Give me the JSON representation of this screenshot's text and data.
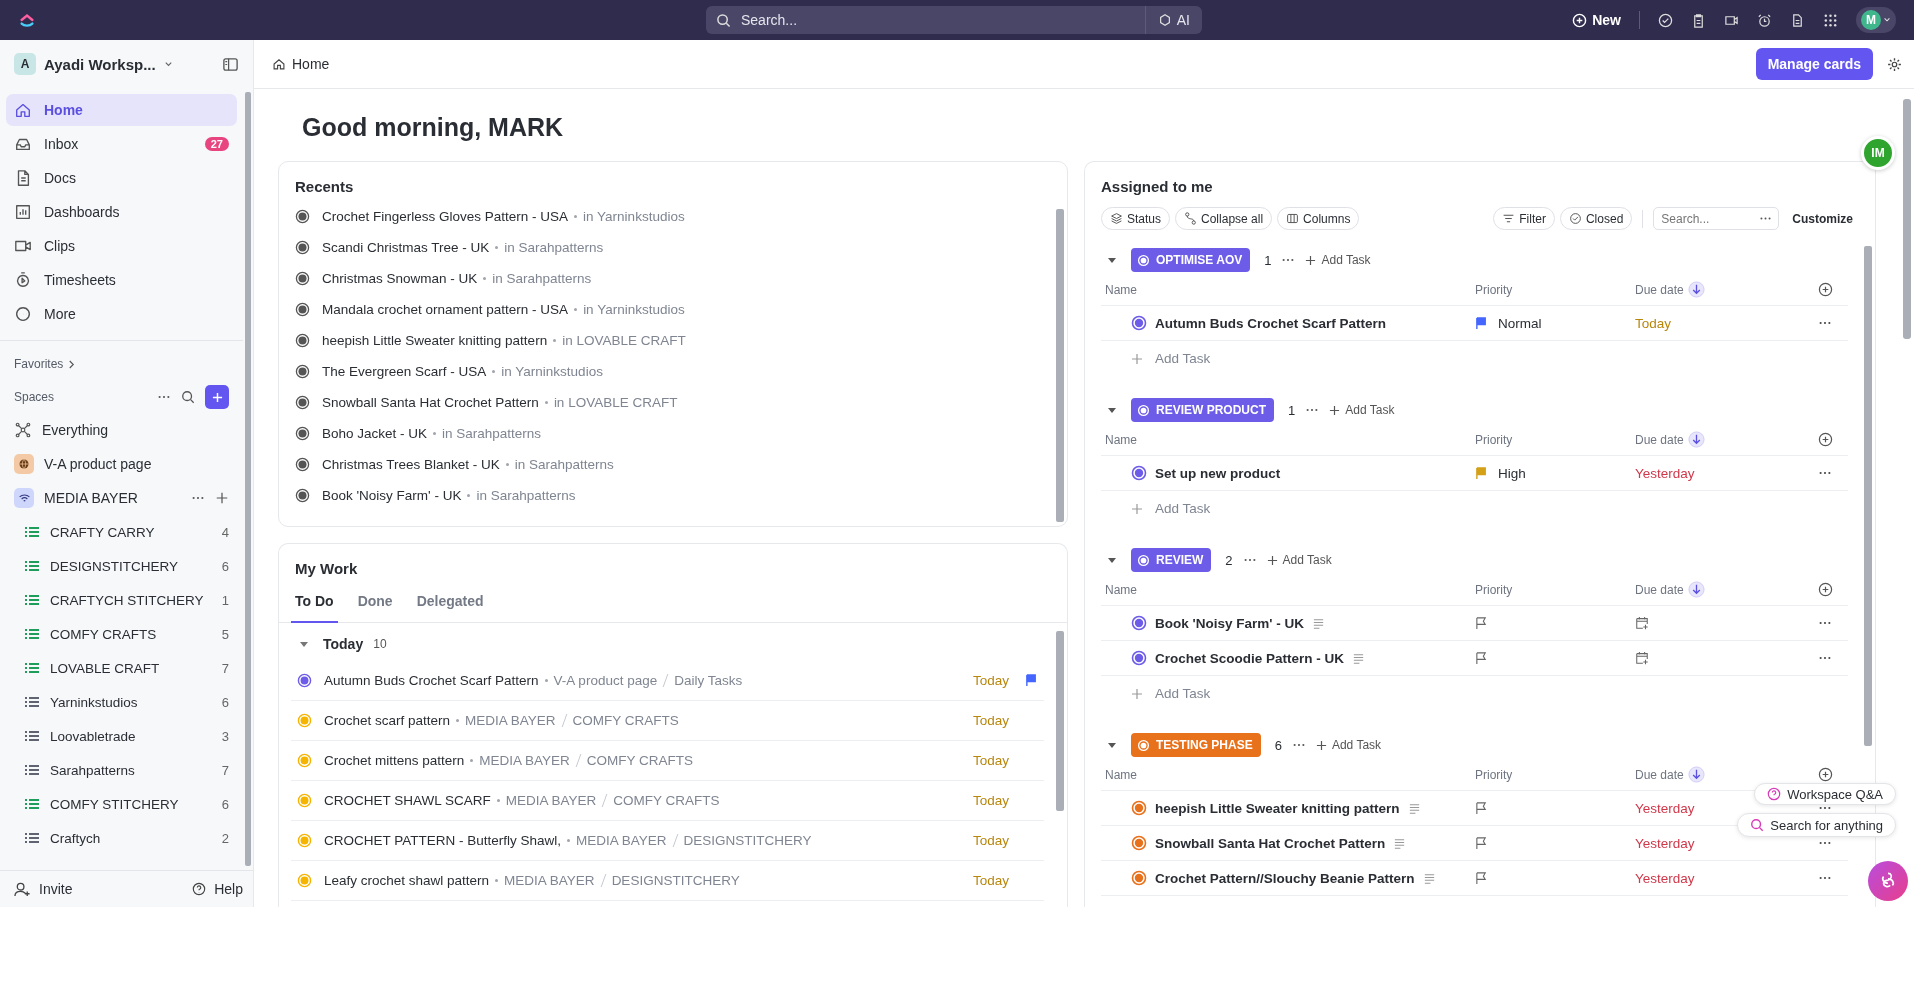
{
  "topbar": {
    "search": {
      "placeholder": "Search..."
    },
    "ai_label": "AI",
    "new_label": "New",
    "avatar": "M"
  },
  "sidebar": {
    "workspace": {
      "initial": "A",
      "name": "Ayadi Worksp..."
    },
    "nav": [
      {
        "label": "Home",
        "selected": true
      },
      {
        "label": "Inbox",
        "selected": false,
        "badge": "27"
      },
      {
        "label": "Docs",
        "selected": false
      },
      {
        "label": "Dashboards",
        "selected": false
      },
      {
        "label": "Clips",
        "selected": false
      },
      {
        "label": "Timesheets",
        "selected": false
      },
      {
        "label": "More",
        "selected": false
      }
    ],
    "favorites_label": "Favorites",
    "spaces_label": "Spaces",
    "spaces": [
      {
        "label": "Everything",
        "kind": "everything"
      },
      {
        "label": "V-A product page",
        "kind": "globe"
      },
      {
        "label": "MEDIA BAYER",
        "kind": "wifi",
        "children": [
          {
            "label": "CRAFTY CARRY",
            "count": "4",
            "color": "#1e9e5a"
          },
          {
            "label": "DESIGNSTITCHERY",
            "count": "6",
            "color": "#1e9e5a"
          },
          {
            "label": "CRAFTYCH STITCHERY",
            "count": "1",
            "color": "#1e9e5a"
          },
          {
            "label": "COMFY CRAFTS",
            "count": "5",
            "color": "#1e9e5a"
          },
          {
            "label": "LOVABLE CRAFT",
            "count": "7",
            "color": "#1e9e5a"
          },
          {
            "label": "Yarninkstudios",
            "count": "6",
            "color": "#5f6470"
          },
          {
            "label": "Loovabletrade",
            "count": "3",
            "color": "#5f6470"
          },
          {
            "label": "Sarahpatterns",
            "count": "7",
            "color": "#5f6470"
          },
          {
            "label": "COMFY STITCHERY",
            "count": "6",
            "color": "#1e9e5a"
          },
          {
            "label": "Craftych",
            "count": "2",
            "color": "#5f6470"
          }
        ]
      }
    ],
    "invite": "Invite",
    "help": "Help"
  },
  "header": {
    "breadcrumb": "Home",
    "manage": "Manage cards"
  },
  "greeting": "Good morning, MARK",
  "recents": {
    "title": "Recents",
    "items": [
      {
        "name": "Crochet Fingerless Gloves Pattern - USA",
        "location": "in Yarninkstudios"
      },
      {
        "name": "Scandi Christmas Tree - UK",
        "location": "in Sarahpatterns"
      },
      {
        "name": "Christmas Snowman - UK",
        "location": "in Sarahpatterns"
      },
      {
        "name": "Mandala crochet ornament pattern - USA",
        "location": "in Yarninkstudios"
      },
      {
        "name": "heepish Little Sweater knitting pattern",
        "location": "in LOVABLE CRAFT"
      },
      {
        "name": "The Evergreen Scarf - USA",
        "location": "in Yarninkstudios"
      },
      {
        "name": "Snowball Santa Hat Crochet Pattern",
        "location": "in LOVABLE CRAFT"
      },
      {
        "name": "Boho Jacket - UK",
        "location": "in Sarahpatterns"
      },
      {
        "name": "Christmas Trees Blanket - UK",
        "location": "in Sarahpatterns"
      },
      {
        "name": "Book 'Noisy Farm' - UK",
        "location": "in Sarahpatterns"
      }
    ]
  },
  "my_work": {
    "title": "My Work",
    "tabs": [
      {
        "label": "To Do",
        "selected": true
      },
      {
        "label": "Done",
        "selected": false
      },
      {
        "label": "Delegated",
        "selected": false
      }
    ],
    "group": {
      "label": "Today",
      "count": "10",
      "expanded": true
    },
    "tasks": [
      {
        "name": "Autumn Buds Crochet Scarf Pattern",
        "space": "V-A product page",
        "list": "Daily Tasks",
        "due": "Today",
        "color": "#6c5ce7",
        "flagged": true
      },
      {
        "name": "Crochet scarf pattern",
        "space": "MEDIA BAYER",
        "list": "COMFY CRAFTS",
        "due": "Today",
        "color": "#f5b400",
        "flagged": false
      },
      {
        "name": "Crochet mittens pattern",
        "space": "MEDIA BAYER",
        "list": "COMFY CRAFTS",
        "due": "Today",
        "color": "#f5b400",
        "flagged": false
      },
      {
        "name": "CROCHET SHAWL SCARF",
        "space": "MEDIA BAYER",
        "list": "COMFY CRAFTS",
        "due": "Today",
        "color": "#f5b400",
        "flagged": false
      },
      {
        "name": "CROCHET PATTERN - Butterfly Shawl,",
        "space": "MEDIA BAYER",
        "list": "DESIGNSTITCHERY",
        "due": "Today",
        "color": "#f5b400",
        "flagged": false
      },
      {
        "name": "Leafy crochet shawl pattern",
        "space": "MEDIA BAYER",
        "list": "DESIGNSTITCHERY",
        "due": "Today",
        "color": "#f5b400",
        "flagged": false
      }
    ]
  },
  "assigned": {
    "title": "Assigned to me",
    "toolbar": [
      {
        "label": "Status"
      },
      {
        "label": "Collapse all"
      },
      {
        "label": "Columns"
      }
    ],
    "filters": [
      {
        "label": "Filter"
      },
      {
        "label": "Closed"
      }
    ],
    "search": {
      "placeholder": "Search..."
    },
    "customize": "Customize",
    "groups": [
      {
        "label": "OPTIMISE AOV",
        "color": "#6c5ce7",
        "count": "1",
        "add": "Add Task",
        "columns": [
          "Name",
          "Priority",
          "Due date"
        ],
        "tasks": [
          {
            "name": "Autumn Buds Crochet Scarf Pattern",
            "priority": {
              "label": "Normal",
              "kind": "normal"
            },
            "due": {
              "label": "Today",
              "kind": "today"
            },
            "has_description": false
          }
        ],
        "add_row": "Add Task"
      },
      {
        "label": "REVIEW PRODUCT",
        "color": "#6c5ce7",
        "count": "1",
        "add": "Add Task",
        "columns": [
          "Name",
          "Priority",
          "Due date"
        ],
        "tasks": [
          {
            "name": "Set up new product",
            "priority": {
              "label": "High",
              "kind": "high"
            },
            "due": {
              "label": "Yesterday",
              "kind": "overdue"
            },
            "has_description": false
          }
        ],
        "add_row": "Add Task"
      },
      {
        "label": "REVIEW",
        "color": "#6c5ce7",
        "count": "2",
        "add": "Add Task",
        "columns": [
          "Name",
          "Priority",
          "Due date"
        ],
        "tasks": [
          {
            "name": "Book 'Noisy Farm' - UK",
            "has_description": true
          },
          {
            "name": "Crochet Scoodie Pattern - UK",
            "has_description": true
          }
        ],
        "add_row": "Add Task"
      },
      {
        "label": "TESTING PHASE",
        "color": "#e8711c",
        "count": "6",
        "add": "Add Task",
        "columns": [
          "Name",
          "Priority",
          "Due date"
        ],
        "tasks": [
          {
            "name": "heepish Little Sweater knitting pattern",
            "due": {
              "label": "Yesterday",
              "kind": "overdue"
            },
            "has_description": true
          },
          {
            "name": "Snowball Santa Hat Crochet Pattern",
            "due": {
              "label": "Yesterday",
              "kind": "overdue"
            },
            "has_description": true
          },
          {
            "name": "Crochet Pattern//Slouchy Beanie Pattern",
            "due": {
              "label": "Yesterday",
              "kind": "overdue"
            },
            "has_description": true
          }
        ]
      }
    ]
  },
  "floating": {
    "presence": "IM",
    "qa": "Workspace Q&A",
    "search": "Search for anything"
  }
}
